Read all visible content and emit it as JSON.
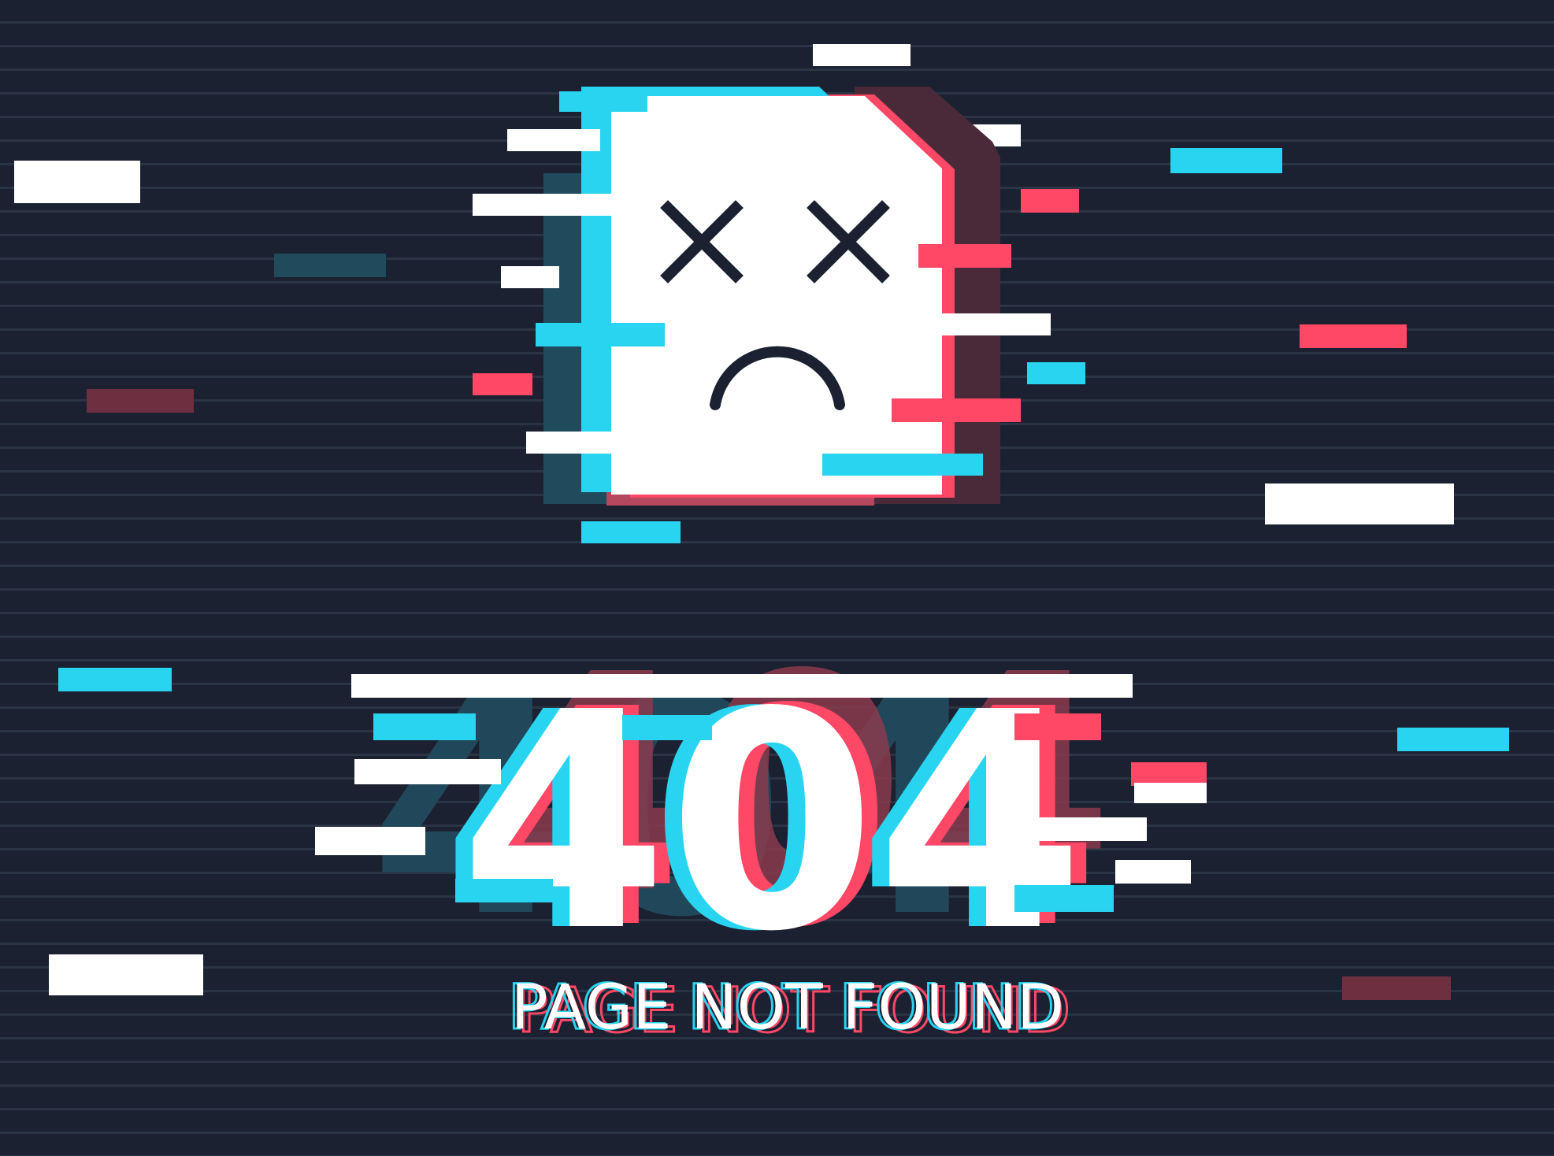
{
  "error": {
    "code": "404",
    "message": "PAGE NOT FOUND"
  },
  "illustration": {
    "icon": "broken-document-dead-face-icon",
    "eyes": "x-eyes",
    "mouth": "frown"
  },
  "colors": {
    "background": "#1b2130",
    "scanline": "#2b3444",
    "white": "#ffffff",
    "cyan": "#28d4f0",
    "red": "#ff4766",
    "dark_cyan": "#1f4b5c",
    "dark_red": "#6e2f41",
    "face_ink": "#1b2130"
  }
}
